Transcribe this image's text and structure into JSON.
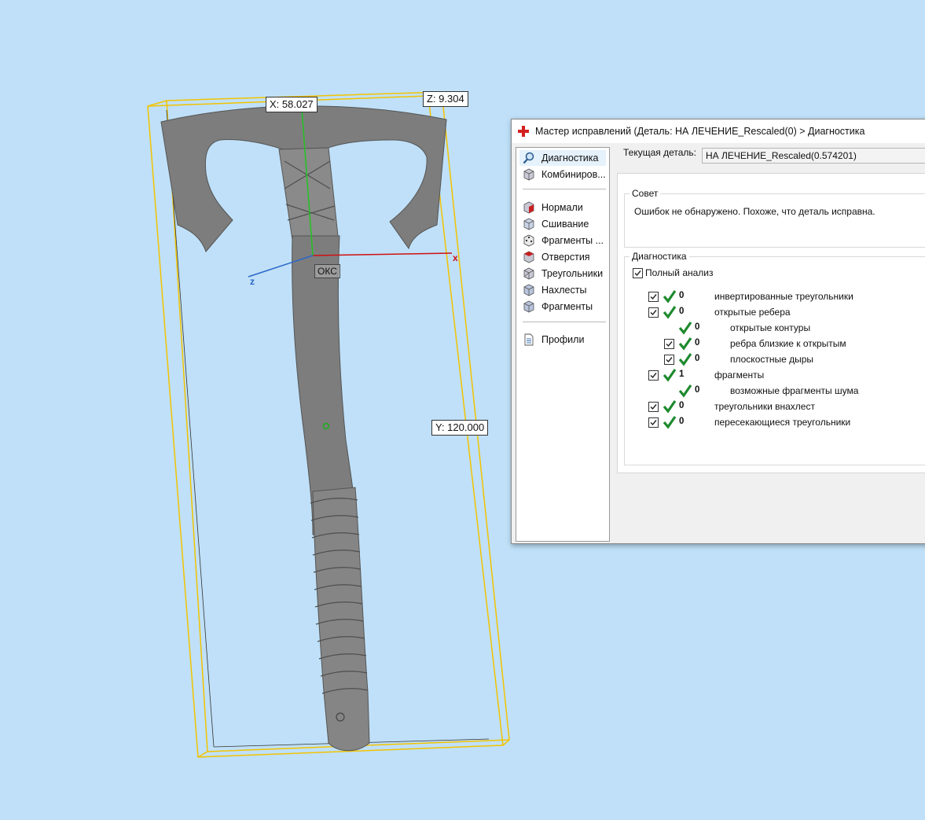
{
  "viewport": {
    "dimensions": {
      "x": "X: 58.027",
      "z": "Z: 9.304",
      "y": "Y: 120.000"
    },
    "axes": {
      "x": "x",
      "z": "z"
    },
    "origin_label": "ОКС"
  },
  "dialog": {
    "title": "Мастер исправлений (Деталь: НА ЛЕЧЕНИЕ_Rescaled(0) > Диагностика",
    "nav": {
      "diagnostics": "Диагностика",
      "combine": "Комбиниров...",
      "normals": "Нормали",
      "stitching": "Сшивание",
      "fragments_more": "Фрагменты ...",
      "holes": "Отверстия",
      "triangles": "Треугольники",
      "overlaps": "Нахлесты",
      "fragments": "Фрагменты",
      "profiles": "Профили"
    },
    "current_part_label": "Текущая деталь:",
    "current_part_value": "НА ЛЕЧЕНИЕ_Rescaled(0.574201)",
    "advice": {
      "title": "Совет",
      "text": "Ошибок не обнаружено. Похоже, что деталь исправна."
    },
    "diagnostics": {
      "title": "Диагностика",
      "full_analysis": "Полный анализ",
      "rows": [
        {
          "count": "0",
          "label": "инвертированные треугольники"
        },
        {
          "count": "0",
          "label": "открытые ребера"
        },
        {
          "count": "0",
          "label": "открытые контуры"
        },
        {
          "count": "0",
          "label": "ребра близкие к открытым"
        },
        {
          "count": "0",
          "label": "плоскостные дыры"
        },
        {
          "count": "1",
          "label": "фрагменты"
        },
        {
          "count": "0",
          "label": "возможные фрагменты шума"
        },
        {
          "count": "0",
          "label": "треугольники внахлест"
        },
        {
          "count": "0",
          "label": "пересекающиеся треугольники"
        }
      ]
    }
  },
  "colors": {
    "background": "#bfe0f8",
    "bbox": "#f2c300",
    "x_axis": "#d01010",
    "y_axis": "#22c422",
    "z_axis": "#2a66c8",
    "model": "#7d7d7d",
    "ok_check": "#1e8a2e"
  },
  "icons": [
    "cross-icon",
    "magnifier-icon",
    "cube-icon",
    "document-icon",
    "checkmark-icon",
    "checkbox-icon"
  ]
}
